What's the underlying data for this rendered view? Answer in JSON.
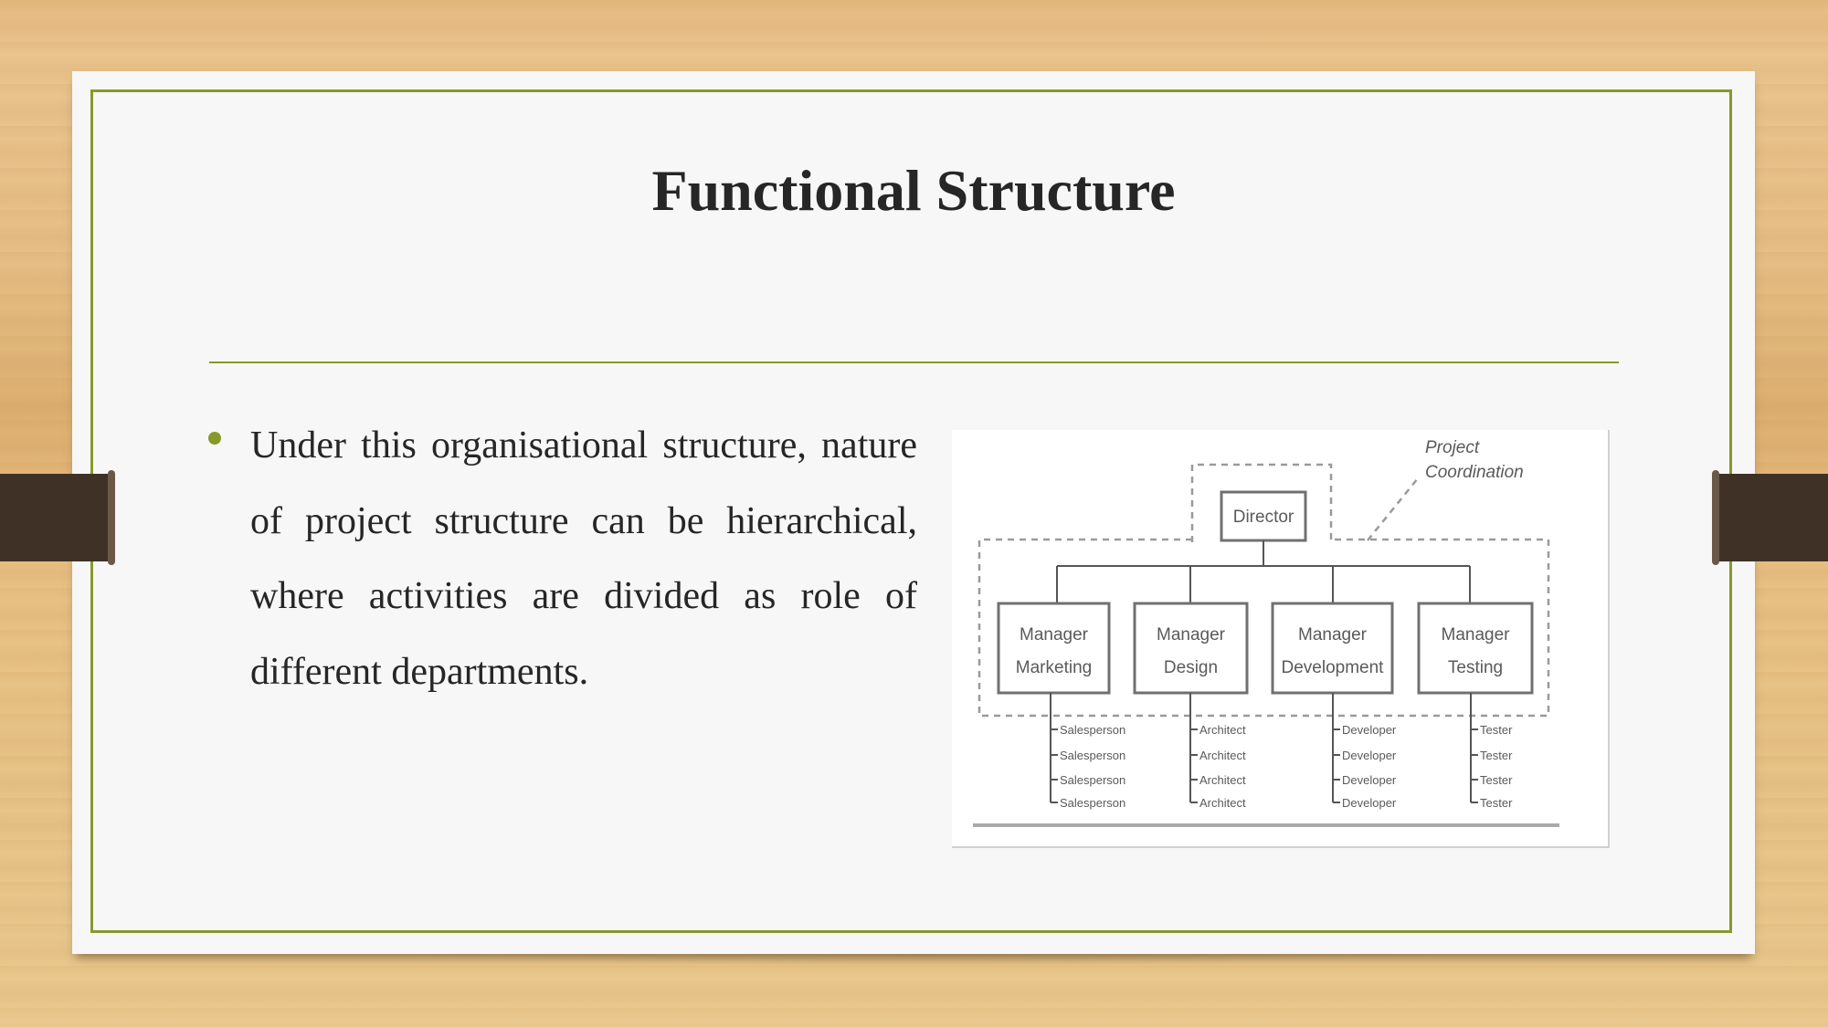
{
  "slide": {
    "title": "Functional Structure",
    "bullets": [
      "Under this organisational structure, nature of project structure can be hierarchical, where activities are divided as role of different departments."
    ]
  },
  "org_chart": {
    "annotation": [
      "Project",
      "Coordination"
    ],
    "director": "Director",
    "managers": [
      {
        "line1": "Manager",
        "line2": "Marketing",
        "staff": [
          "Salesperson",
          "Salesperson",
          "Salesperson",
          "Salesperson"
        ]
      },
      {
        "line1": "Manager",
        "line2": "Design",
        "staff": [
          "Architect",
          "Architect",
          "Architect",
          "Architect"
        ]
      },
      {
        "line1": "Manager",
        "line2": "Development",
        "staff": [
          "Developer",
          "Developer",
          "Developer",
          "Developer"
        ]
      },
      {
        "line1": "Manager",
        "line2": "Testing",
        "staff": [
          "Tester",
          "Tester",
          "Tester",
          "Tester"
        ]
      }
    ]
  },
  "theme": {
    "accent": "#86992b",
    "text": "#262626",
    "strap": "#3f3125"
  }
}
